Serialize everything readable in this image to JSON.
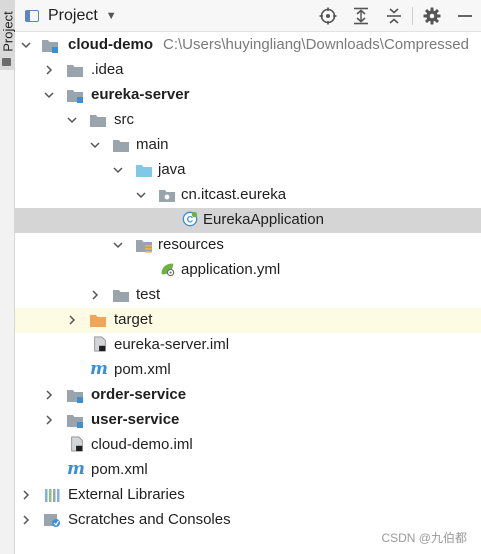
{
  "side_tab": {
    "label": "Project"
  },
  "header": {
    "title": "Project"
  },
  "tree": {
    "cloud_demo": {
      "label": "cloud-demo",
      "path": "C:\\Users\\huyingliang\\Downloads\\Compressed"
    },
    "idea": {
      "label": ".idea"
    },
    "eureka_server": {
      "label": "eureka-server"
    },
    "src": {
      "label": "src"
    },
    "main": {
      "label": "main"
    },
    "java": {
      "label": "java"
    },
    "package": {
      "label": "cn.itcast.eureka"
    },
    "eureka_application": {
      "label": "EurekaApplication"
    },
    "resources": {
      "label": "resources"
    },
    "application_yml": {
      "label": "application.yml"
    },
    "test": {
      "label": "test"
    },
    "target": {
      "label": "target"
    },
    "eureka_server_iml": {
      "label": "eureka-server.iml"
    },
    "pom_eureka": {
      "label": "pom.xml"
    },
    "order_service": {
      "label": "order-service"
    },
    "user_service": {
      "label": "user-service"
    },
    "cloud_demo_iml": {
      "label": "cloud-demo.iml"
    },
    "pom_root": {
      "label": "pom.xml"
    },
    "external_libraries": {
      "label": "External Libraries"
    },
    "scratches": {
      "label": "Scratches and Consoles"
    }
  },
  "watermark": "CSDN @九伯都",
  "colors": {
    "selected_row": "#d5d5d5",
    "highlight_row": "#fdfbe3",
    "folder_gray": "#9aa4ad",
    "source_folder": "#7ec8e8",
    "excluded_folder": "#f0a45c",
    "module_blue": "#3c8fd6"
  }
}
